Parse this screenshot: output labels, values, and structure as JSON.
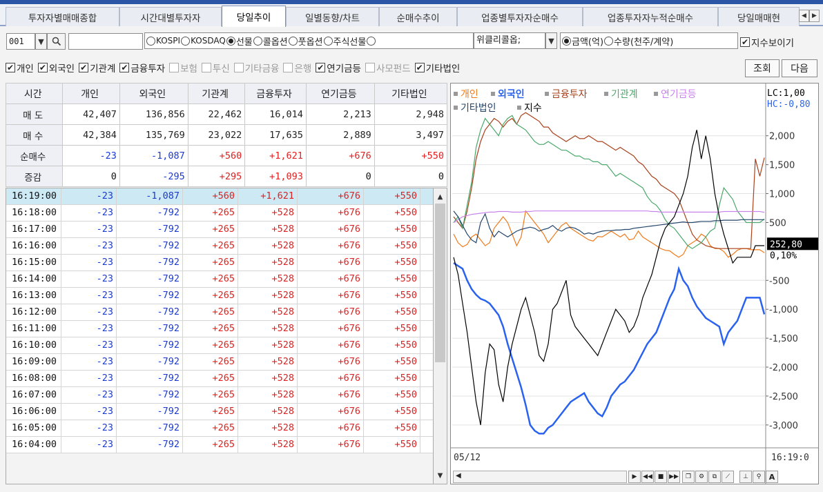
{
  "tabs": [
    {
      "label": "투자자별매매종합",
      "active": false
    },
    {
      "label": "시간대별투자자",
      "active": false
    },
    {
      "label": "당일추이",
      "active": true
    },
    {
      "label": "일별동향/차트",
      "active": false
    },
    {
      "label": "순매수추이",
      "active": false
    },
    {
      "label": "업종별투자자순매수",
      "active": false
    },
    {
      "label": "업종투자자누적순매수",
      "active": false
    },
    {
      "label": "당일매매현",
      "active": false
    }
  ],
  "code": {
    "value": "001"
  },
  "markets": [
    {
      "label": "KOSPI",
      "selected": false
    },
    {
      "label": "KOSDAQ",
      "selected": false
    },
    {
      "label": "선물",
      "selected": true
    },
    {
      "label": "콜옵션",
      "selected": false
    },
    {
      "label": "풋옵션",
      "selected": false
    },
    {
      "label": "주식선물",
      "selected": false
    }
  ],
  "weekly_select": "위클리콜옵;",
  "units": [
    {
      "label": "금액(억)",
      "selected": true
    },
    {
      "label": "수량(천주/계약)",
      "selected": false
    }
  ],
  "show_index_label": "지수보이기",
  "investors": [
    {
      "label": "개인",
      "checked": true
    },
    {
      "label": "외국인",
      "checked": true
    },
    {
      "label": "기관계",
      "checked": true
    },
    {
      "label": "금융투자",
      "checked": true
    },
    {
      "label": "보험",
      "checked": false
    },
    {
      "label": "투신",
      "checked": false
    },
    {
      "label": "기타금융",
      "checked": false
    },
    {
      "label": "은행",
      "checked": false
    },
    {
      "label": "연기금등",
      "checked": true
    },
    {
      "label": "사모펀드",
      "checked": false
    },
    {
      "label": "기타법인",
      "checked": true
    }
  ],
  "check_mark": "✔",
  "buttons": {
    "query": "조회",
    "next": "다음"
  },
  "summary": {
    "headers": [
      "시간",
      "개인",
      "외국인",
      "기관계",
      "금융투자",
      "연기금등",
      "기타법인"
    ],
    "rows": [
      {
        "label": "매 도",
        "values": [
          "42,407",
          "136,856",
          "22,462",
          "16,014",
          "2,213",
          "2,948"
        ]
      },
      {
        "label": "매 수",
        "values": [
          "42,384",
          "135,769",
          "23,022",
          "17,635",
          "2,889",
          "3,497"
        ]
      },
      {
        "label": "순매수",
        "values": [
          "-23",
          "-1,087",
          "+560",
          "+1,621",
          "+676",
          "+550"
        ]
      },
      {
        "label": "증감",
        "values": [
          "0",
          "-295",
          "+295",
          "+1,093",
          "0",
          "0"
        ]
      }
    ]
  },
  "list_rows": [
    {
      "time": "16:19:00",
      "values": [
        "-23",
        "-1,087",
        "+560",
        "+1,621",
        "+676",
        "+550"
      ]
    },
    {
      "time": "16:18:00",
      "values": [
        "-23",
        "-792",
        "+265",
        "+528",
        "+676",
        "+550"
      ]
    },
    {
      "time": "16:17:00",
      "values": [
        "-23",
        "-792",
        "+265",
        "+528",
        "+676",
        "+550"
      ]
    },
    {
      "time": "16:16:00",
      "values": [
        "-23",
        "-792",
        "+265",
        "+528",
        "+676",
        "+550"
      ]
    },
    {
      "time": "16:15:00",
      "values": [
        "-23",
        "-792",
        "+265",
        "+528",
        "+676",
        "+550"
      ]
    },
    {
      "time": "16:14:00",
      "values": [
        "-23",
        "-792",
        "+265",
        "+528",
        "+676",
        "+550"
      ]
    },
    {
      "time": "16:13:00",
      "values": [
        "-23",
        "-792",
        "+265",
        "+528",
        "+676",
        "+550"
      ]
    },
    {
      "time": "16:12:00",
      "values": [
        "-23",
        "-792",
        "+265",
        "+528",
        "+676",
        "+550"
      ]
    },
    {
      "time": "16:11:00",
      "values": [
        "-23",
        "-792",
        "+265",
        "+528",
        "+676",
        "+550"
      ]
    },
    {
      "time": "16:10:00",
      "values": [
        "-23",
        "-792",
        "+265",
        "+528",
        "+676",
        "+550"
      ]
    },
    {
      "time": "16:09:00",
      "values": [
        "-23",
        "-792",
        "+265",
        "+528",
        "+676",
        "+550"
      ]
    },
    {
      "time": "16:08:00",
      "values": [
        "-23",
        "-792",
        "+265",
        "+528",
        "+676",
        "+550"
      ]
    },
    {
      "time": "16:07:00",
      "values": [
        "-23",
        "-792",
        "+265",
        "+528",
        "+676",
        "+550"
      ]
    },
    {
      "time": "16:06:00",
      "values": [
        "-23",
        "-792",
        "+265",
        "+528",
        "+676",
        "+550"
      ]
    },
    {
      "time": "16:05:00",
      "values": [
        "-23",
        "-792",
        "+265",
        "+528",
        "+676",
        "+550"
      ]
    },
    {
      "time": "16:04:00",
      "values": [
        "-23",
        "-792",
        "+265",
        "+528",
        "+676",
        "+550"
      ]
    }
  ],
  "colors": {
    "negative": "#1a37d8",
    "positive": "#e02020",
    "selected_row": "#cde9f4",
    "tab_accent": "#2b56a6"
  },
  "chart_data": {
    "type": "line",
    "legend": [
      {
        "name": "개인",
        "color": "#f07a1a"
      },
      {
        "name": "외국인",
        "color": "#2a62f0"
      },
      {
        "name": "금융투자",
        "color": "#a8401a"
      },
      {
        "name": "기관계",
        "color": "#4aa86a"
      },
      {
        "name": "연기금등",
        "color": "#c884ea"
      },
      {
        "name": "기타법인",
        "color": "#22446a"
      },
      {
        "name": "지수",
        "color": "#000000"
      }
    ],
    "legend_placement": "top-left",
    "ylim": [
      -3300,
      2450
    ],
    "yticks": [
      "2,000",
      "1,500",
      "1,000",
      "500",
      "-500",
      "-1,000",
      "-1,500",
      "-2,000",
      "-2,500",
      "-3,000"
    ],
    "ytick_values": [
      2000,
      1500,
      1000,
      500,
      -500,
      -1000,
      -1500,
      -2000,
      -2500,
      -3000
    ],
    "gridlines": true,
    "x_start_label": "05/12",
    "x_end_label": "16:19:0",
    "lc_label": "LC:1,00",
    "hc_label": "HC:-0,80",
    "price_tag": "252,80",
    "price_tag_value": 120,
    "pct_tag": "0,10%",
    "series": [
      {
        "name": "외국인",
        "color": "#2a62f0",
        "values": [
          -200,
          -250,
          -300,
          -500,
          -650,
          -750,
          -820,
          -850,
          -900,
          -1000,
          -1100,
          -1300,
          -1600,
          -1850,
          -2100,
          -2350,
          -2650,
          -3000,
          -3100,
          -3150,
          -3150,
          -3050,
          -3000,
          -2900,
          -2800,
          -2700,
          -2600,
          -2550,
          -2500,
          -2450,
          -2600,
          -2700,
          -2800,
          -2850,
          -2700,
          -2500,
          -2400,
          -2300,
          -2250,
          -2150,
          -2050,
          -1900,
          -1750,
          -1600,
          -1500,
          -1400,
          -1200,
          -1000,
          -800,
          -650,
          -300,
          -500,
          -600,
          -800,
          -950,
          -1050,
          -1150,
          -1200,
          -1250,
          -1300,
          -1600,
          -1400,
          -1300,
          -1200,
          -1000,
          -800,
          -800,
          -800,
          -800,
          -1087
        ]
      },
      {
        "name": "개인",
        "color": "#f07a1a",
        "values": [
          300,
          150,
          80,
          120,
          250,
          300,
          200,
          100,
          150,
          400,
          500,
          600,
          500,
          300,
          100,
          250,
          700,
          600,
          500,
          400,
          300,
          150,
          250,
          350,
          450,
          500,
          400,
          350,
          300,
          250,
          200,
          180,
          260,
          250,
          300,
          350,
          300,
          250,
          300,
          200,
          220,
          350,
          250,
          200,
          150,
          100,
          50,
          20,
          10,
          -50,
          -100,
          -50,
          100,
          150,
          200,
          300,
          250,
          100,
          50,
          50,
          0,
          -100,
          -50,
          20,
          50,
          50,
          30,
          30,
          30,
          -23
        ]
      },
      {
        "name": "금융투자",
        "color": "#a8401a",
        "values": [
          600,
          500,
          400,
          700,
          1100,
          1600,
          1900,
          2100,
          2200,
          2300,
          2250,
          2150,
          2250,
          2300,
          2200,
          2350,
          2400,
          2350,
          2300,
          2250,
          2150,
          2150,
          2050,
          2000,
          1950,
          1900,
          1950,
          2000,
          1950,
          1950,
          2000,
          1950,
          1900,
          1900,
          1850,
          1800,
          1750,
          1800,
          1750,
          1700,
          1650,
          1550,
          1500,
          1400,
          1300,
          1250,
          1150,
          1100,
          1050,
          1000,
          900,
          700,
          500,
          300,
          200,
          150,
          100,
          80,
          60,
          50,
          50,
          50,
          50,
          50,
          50,
          50,
          50,
          1600,
          1300,
          1621
        ]
      },
      {
        "name": "기관계",
        "color": "#4aa86a",
        "values": [
          500,
          600,
          400,
          800,
          1200,
          1800,
          2100,
          2300,
          2200,
          2100,
          2000,
          2200,
          2300,
          2350,
          2200,
          2150,
          2100,
          2000,
          1900,
          1850,
          1850,
          1900,
          1850,
          1800,
          1750,
          1750,
          1700,
          1650,
          1650,
          1600,
          1600,
          1550,
          1550,
          1500,
          1500,
          1400,
          1300,
          1350,
          1300,
          1250,
          1200,
          1150,
          1100,
          950,
          850,
          800,
          700,
          550,
          450,
          400,
          300,
          200,
          100,
          50,
          100,
          150,
          250,
          350,
          400,
          800,
          1100,
          1000,
          900,
          700,
          600,
          500,
          500,
          500,
          500,
          560
        ]
      },
      {
        "name": "연기금등",
        "color": "#c884ea",
        "values": [
          500,
          550,
          600,
          620,
          640,
          650,
          660,
          670,
          680,
          680,
          690,
          690,
          690,
          680,
          680,
          680,
          690,
          690,
          700,
          700,
          700,
          700,
          700,
          700,
          700,
          700,
          700,
          700,
          700,
          700,
          700,
          700,
          700,
          700,
          700,
          700,
          700,
          700,
          700,
          700,
          700,
          700,
          700,
          700,
          690,
          690,
          680,
          680,
          680,
          680,
          680,
          680,
          680,
          680,
          680,
          680,
          680,
          680,
          680,
          680,
          690,
          690,
          690,
          690,
          690,
          690,
          690,
          690,
          690,
          676
        ]
      },
      {
        "name": "기타법인",
        "color": "#22446a",
        "values": [
          700,
          600,
          450,
          300,
          200,
          150,
          500,
          650,
          400,
          250,
          350,
          300,
          250,
          300,
          350,
          380,
          400,
          420,
          400,
          350,
          380,
          400,
          450,
          380,
          350,
          400,
          420,
          400,
          360,
          300,
          320,
          300,
          330,
          350,
          360,
          360,
          370,
          370,
          380,
          380,
          400,
          410,
          420,
          430,
          440,
          450,
          460,
          470,
          480,
          490,
          500,
          510,
          500,
          500,
          510,
          520,
          520,
          520,
          530,
          530,
          540,
          540,
          540,
          540,
          550,
          550,
          550,
          550,
          550,
          550
        ]
      },
      {
        "name": "지수",
        "color": "#000000",
        "values": [
          -100,
          -400,
          -900,
          -1400,
          -2000,
          -2600,
          -3000,
          -2100,
          -1600,
          -1700,
          -2300,
          -2600,
          -2000,
          -1600,
          -1300,
          -1000,
          -800,
          -1100,
          -1400,
          -1800,
          -1900,
          -1600,
          -1000,
          -900,
          -700,
          -500,
          -1100,
          -1300,
          -1400,
          -1500,
          -1600,
          -1700,
          -1800,
          -1600,
          -1400,
          -1200,
          -1000,
          -1100,
          -1200,
          -1400,
          -1300,
          -1100,
          -800,
          -600,
          -400,
          -100,
          200,
          400,
          500,
          600,
          800,
          1000,
          1300,
          1800,
          2100,
          1600,
          2000,
          1600,
          1000,
          600,
          300,
          50,
          -200,
          -100,
          -100,
          -100,
          -100,
          100,
          100,
          100
        ]
      }
    ]
  }
}
